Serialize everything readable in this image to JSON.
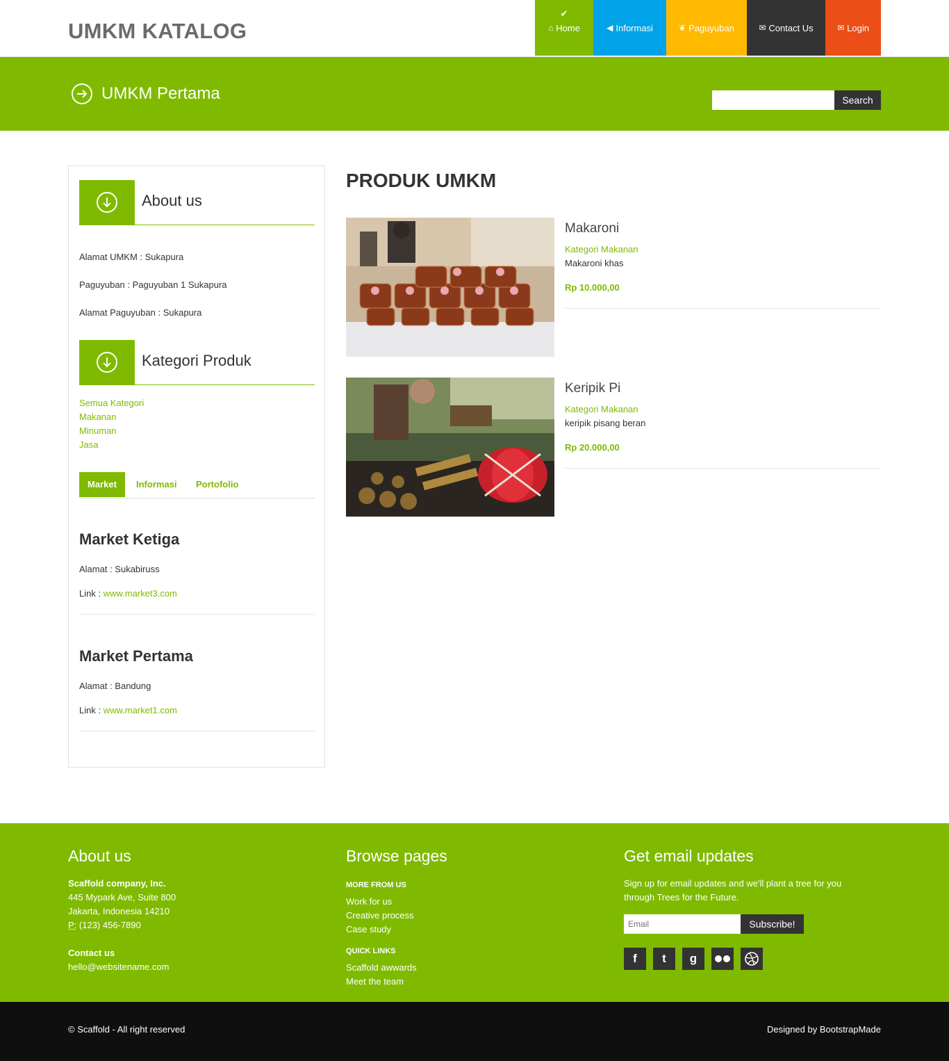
{
  "header": {
    "brand": "UMKM KATALOG",
    "nav": {
      "home": "Home",
      "informasi": "Informasi",
      "paguyuban": "Paguyuban",
      "contact": "Contact Us",
      "login": "Login"
    }
  },
  "subbar": {
    "title": "UMKM Pertama",
    "search_button": "Search",
    "search_placeholder": ""
  },
  "sidebar": {
    "about_title": "About us",
    "about_lines": [
      "Alamat UMKM : Sukapura",
      "Paguyuban : Paguyuban 1 Sukapura",
      "Alamat Paguyuban : Sukapura"
    ],
    "kategori_title": "Kategori Produk",
    "categories": [
      "Semua Kategori",
      "Makanan",
      "Minuman",
      "Jasa"
    ],
    "tabs": [
      "Market",
      "Informasi",
      "Portofolio"
    ],
    "markets": [
      {
        "name": "Market Ketiga",
        "alamat": "Alamat : Sukabiruss",
        "link_label": "Link : ",
        "link": "www.market3.com"
      },
      {
        "name": "Market Pertama",
        "alamat": "Alamat : Bandung",
        "link_label": "Link : ",
        "link": "www.market1.com"
      }
    ]
  },
  "main": {
    "title": "PRODUK UMKM",
    "products": [
      {
        "name": "Makaroni",
        "category": "Kategori Makanan",
        "description": "Makaroni khas",
        "price": "Rp 10.000,00"
      },
      {
        "name": "Keripik Pi",
        "category": "Kategori Makanan",
        "description": "keripik pisang beran",
        "price": "Rp 20.000,00"
      }
    ]
  },
  "footer": {
    "about_title": "About us",
    "company": "Scaffold company, Inc.",
    "address1": "445 Mypark Ave, Suite 800",
    "address2": "Jakarta, Indonesia 14210",
    "phone_label": "P:",
    "phone": " (123) 456-7890",
    "contact_title": "Contact us",
    "email": "hello@websitename.com",
    "browse_title": "Browse pages",
    "more_title": "MORE FROM US",
    "more_links": [
      "Work for us",
      "Creative process",
      "Case study"
    ],
    "quick_title": "QUICK LINKS",
    "quick_links": [
      "Scaffold awwards",
      "Meet the team"
    ],
    "email_title": "Get email updates",
    "email_text1": "Sign up for email updates and we'll plant a tree for you",
    "email_text2": "through Trees for the Future.",
    "email_placeholder": "Email",
    "subscribe": "Subscribe!",
    "social": [
      "facebook-icon",
      "twitter-icon",
      "google-icon",
      "flickr-icon",
      "dribbble-icon"
    ]
  },
  "bottom": {
    "copyright": "© Scaffold - All right reserved",
    "designed": "Designed by BootstrapMade"
  },
  "colors": {
    "green": "#7fba00",
    "blue": "#00a3e8",
    "yellow": "#ffb900",
    "dark": "#333333",
    "orange": "#eb4e16",
    "black": "#0f0f0f"
  }
}
